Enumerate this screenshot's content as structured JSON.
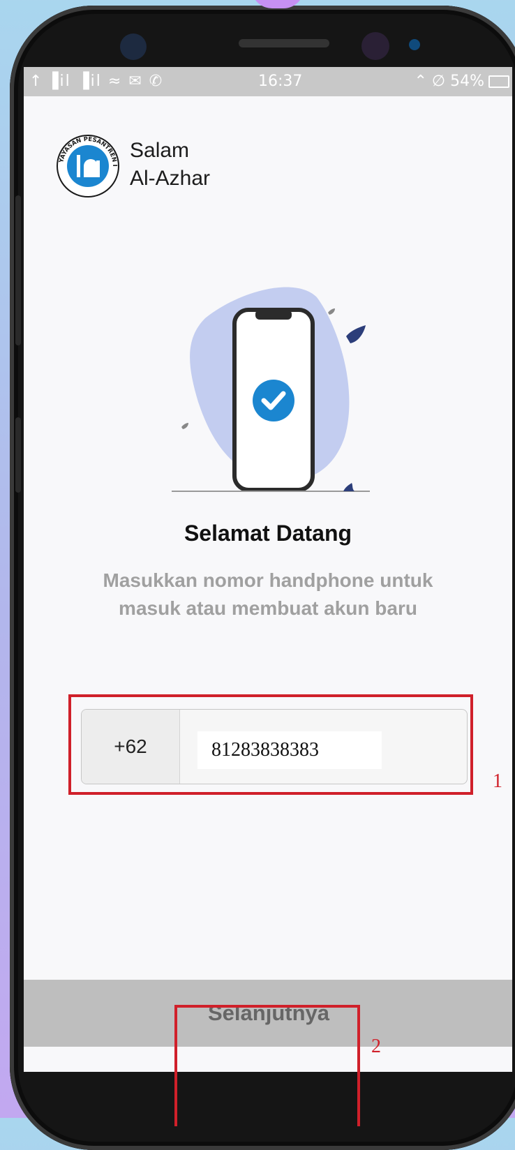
{
  "status_bar": {
    "left_icons": "↑ ▐il ▐il ≈ ✉ ✆",
    "time": "16:37",
    "right_icons": "⌃ ∅",
    "battery": "54%"
  },
  "app": {
    "name_line1": "Salam",
    "name_line2": "Al-Azhar",
    "logo_text": "YAYASAN PESANTREN ISLAM AL AZHAR"
  },
  "welcome": {
    "title": "Selamat Datang",
    "subtitle_line1": "Masukkan nomor handphone untuk",
    "subtitle_line2": "masuk atau membuat akun baru"
  },
  "phone_input": {
    "country_code": "+62",
    "value": "81283838383"
  },
  "next_button": {
    "label": "Selanjutnya"
  },
  "annotations": {
    "label_1": "1",
    "label_2": "2"
  },
  "colors": {
    "accent_blue": "#1b86d0",
    "blob": "#c3cdf0",
    "annotation_red": "#d0202a"
  }
}
